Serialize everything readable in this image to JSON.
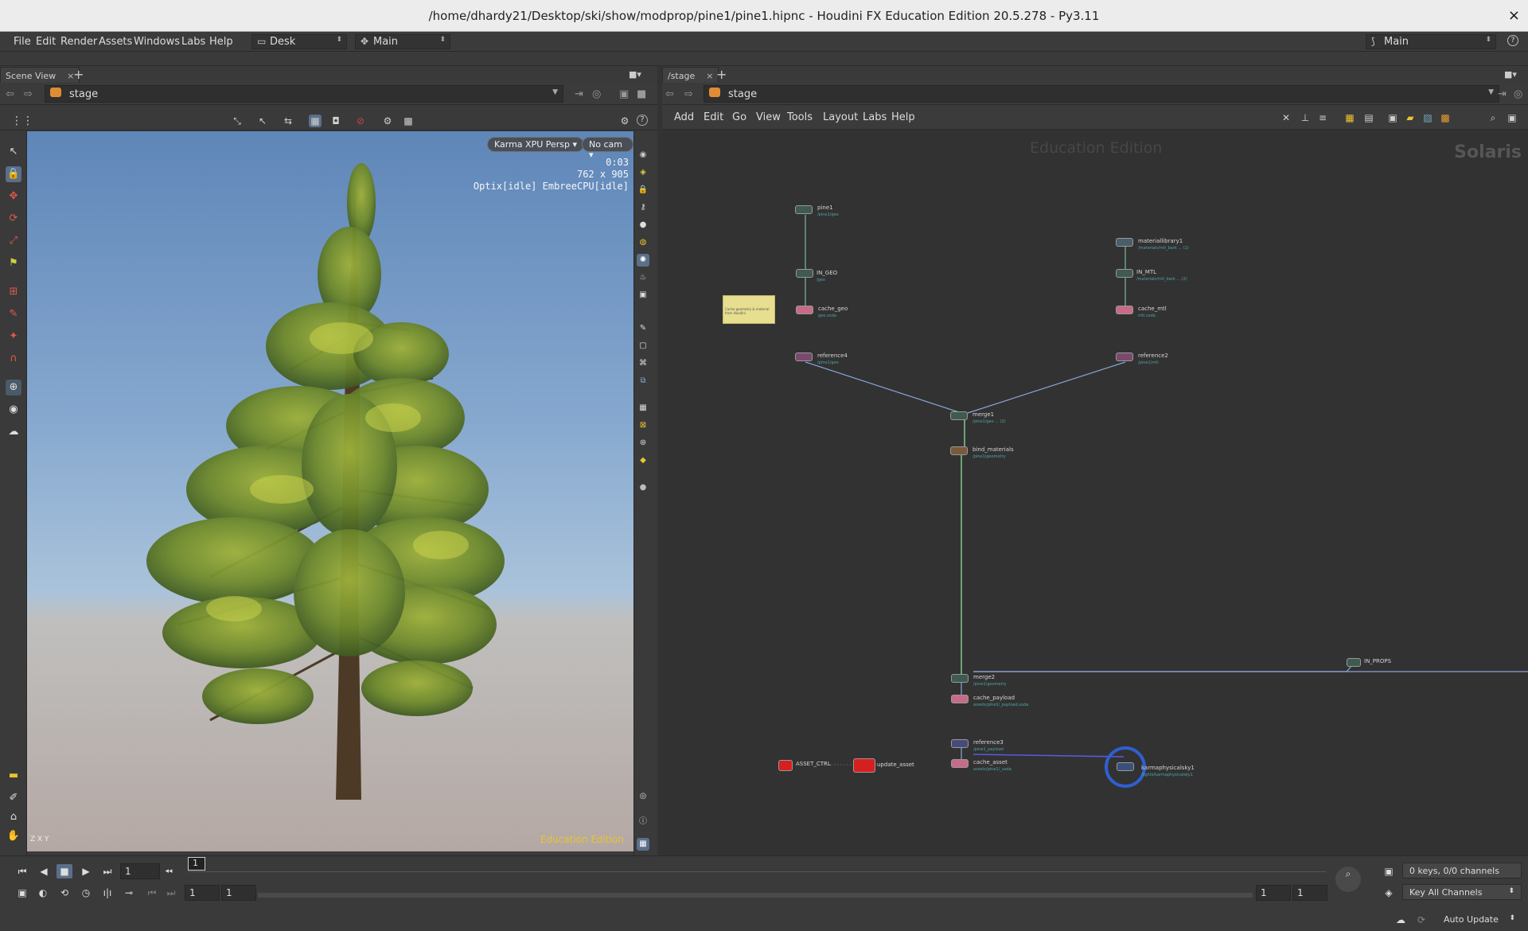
{
  "window": {
    "title": "/home/dhardy21/Desktop/ski/show/modprop/pine1/pine1.hipnc - Houdini FX Education Edition 20.5.278 - Py3.11",
    "close": "×"
  },
  "menubar": {
    "items": [
      "File",
      "Edit",
      "Render",
      "Assets",
      "Windows",
      "Labs",
      "Help"
    ],
    "desk_label": "Desk",
    "main_label": "Main",
    "right_main_label": "Main"
  },
  "left_pane": {
    "tab_label": "Scene View",
    "path": "stage",
    "renderer_label": "Karma XPU Persp",
    "camera_label": "No cam",
    "stats": {
      "time": "0:03",
      "resolution": "762 x 905",
      "devices": "Optix[idle] EmbreeCPU[idle]"
    },
    "edu_label": "Education Edition",
    "axis_label": "Z X Y"
  },
  "right_pane": {
    "tab_label": "/stage",
    "path": "stage",
    "menu": [
      "Add",
      "Edit",
      "Go",
      "View",
      "Tools",
      "Layout",
      "Labs",
      "Help"
    ],
    "watermark": "Education Edition",
    "context_label": "Solaris",
    "sticky_note": "Cache geometry & material from Houdini",
    "nodes": [
      {
        "name": "pine1",
        "sub": "/pine1/geo",
        "color": "#3f5a4f"
      },
      {
        "name": "IN_GEO",
        "sub": "/geo",
        "color": "#3f5a4f"
      },
      {
        "name": "cache_geo",
        "sub": "geo.usda",
        "color": "#c86b86"
      },
      {
        "name": "materiallibrary1",
        "sub": "/materials/mtl_bark ... (2)",
        "color": "#4a5e6a"
      },
      {
        "name": "IN_MTL",
        "sub": "/materials/mtl_bark ... (2)",
        "color": "#3f5a4f"
      },
      {
        "name": "cache_mtl",
        "sub": "mtl.usda",
        "color": "#c86b86"
      },
      {
        "name": "reference4",
        "sub": "/pine1/geo",
        "color": "#7a4a6e"
      },
      {
        "name": "reference2",
        "sub": "/pine1/mtl",
        "color": "#7a4a6e"
      },
      {
        "name": "merge1",
        "sub": "/pine1/geo ... (2)",
        "color": "#3f5a4f"
      },
      {
        "name": "bind_materials",
        "sub": "/pine1/geometry",
        "color": "#7a5a3a"
      },
      {
        "name": "IN_PROPS",
        "sub": "",
        "color": "#3f5a4f"
      },
      {
        "name": "merge2",
        "sub": "/pine1/geometry",
        "color": "#3f5a4f"
      },
      {
        "name": "cache_payload",
        "sub": "assets/pine1/_payload.usda",
        "color": "#c86b86"
      },
      {
        "name": "reference3",
        "sub": "/pine1_payload",
        "color": "#4a4a7a"
      },
      {
        "name": "cache_asset",
        "sub": "assets/pine1/_usda",
        "color": "#c86b86"
      },
      {
        "name": "ASSET_CTRL",
        "sub": "",
        "color": "#d62020"
      },
      {
        "name": "update_asset",
        "sub": "",
        "color": "#d62020"
      },
      {
        "name": "karmaphysicalsky1",
        "sub": "/lights/karmaphysicalsky1",
        "color": "#3a4f7a"
      }
    ]
  },
  "timeline": {
    "current_frame": "1",
    "frame_marker": "1",
    "range_start": "1",
    "range_end": "1",
    "playback_start": "1",
    "playback_end": "1",
    "channels_label": "0 keys, 0/0 channels",
    "key_all_label": "Key All Channels",
    "auto_update_label": "Auto Update"
  },
  "colors": {
    "accent": "#4f7fd0",
    "node_line": "#8aa6d8",
    "edu_yellow": "#e8c530"
  }
}
